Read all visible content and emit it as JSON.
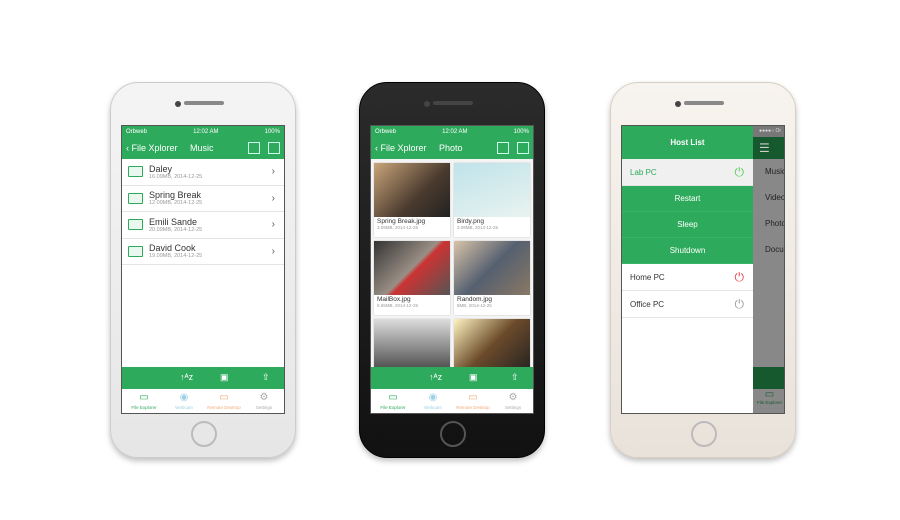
{
  "status": {
    "carrier": "Orbweb",
    "time": "12:02 AM",
    "battery": "100%"
  },
  "app": {
    "back_label": "File Xplorer",
    "accent": "#2eaa5c"
  },
  "phone1": {
    "title": "Music",
    "items": [
      {
        "name": "Daley",
        "meta": "16.09MB, 2014-12-25"
      },
      {
        "name": "Spring Break",
        "meta": "12.09MB, 2014-12-25"
      },
      {
        "name": "Emili Sande",
        "meta": "20.09MB, 2014-12-25"
      },
      {
        "name": "David Cook",
        "meta": "19.09MB, 2014-12-25"
      }
    ]
  },
  "toolbar": {
    "sort_icon": "sort-az-icon",
    "new_folder_icon": "new-folder-icon",
    "upload_icon": "upload-icon"
  },
  "tabs": [
    {
      "label": "File Explorer",
      "icon": "folder-icon"
    },
    {
      "label": "Webcam",
      "icon": "webcam-icon"
    },
    {
      "label": "Remote Desktop",
      "icon": "monitor-icon"
    },
    {
      "label": "Settings",
      "icon": "gear-icon"
    }
  ],
  "phone2": {
    "title": "Photo",
    "photos": [
      {
        "name": "Spring Break.jpg",
        "meta": "3.09MB, 2014-12-25"
      },
      {
        "name": "Birdy.png",
        "meta": "3.09MB, 2014-12-25"
      },
      {
        "name": "MailBox.jpg",
        "meta": "5.65MB, 2014-12-25"
      },
      {
        "name": "Random.jpg",
        "meta": "8MB, 2014-12-25"
      }
    ]
  },
  "phone3": {
    "title": "Host List",
    "hosts": [
      {
        "name": "Lab PC",
        "state": "on"
      },
      {
        "name": "Home PC",
        "state": "off-red"
      },
      {
        "name": "Office PC",
        "state": "off"
      }
    ],
    "actions": [
      "Restart",
      "Sleep",
      "Shutdown"
    ],
    "behind_items": [
      "Music",
      "Video",
      "Photo",
      "Docum"
    ],
    "behind_tab": "File Explorer"
  }
}
